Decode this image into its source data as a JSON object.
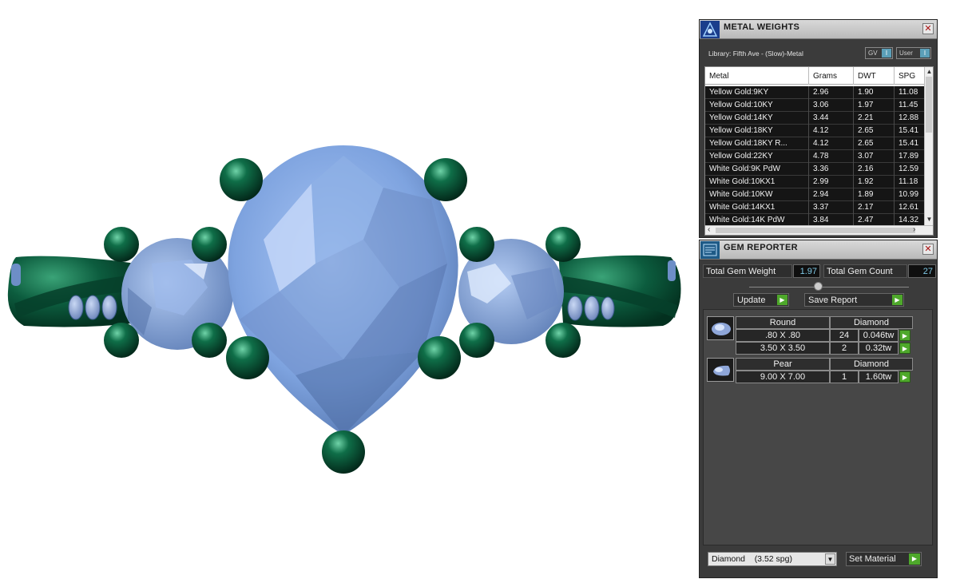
{
  "metal_panel": {
    "title": "METAL WEIGHTS",
    "library_label": "Library: Fifth Ave - (Slow)-Metal",
    "gv_label": "GV",
    "user_label": "User",
    "toggle_glyph": "I",
    "columns": [
      "Metal",
      "Grams",
      "DWT",
      "SPG"
    ],
    "rows": [
      {
        "metal": "Yellow Gold:9KY",
        "grams": "2.96",
        "dwt": "1.90",
        "spg": "11.08"
      },
      {
        "metal": "Yellow Gold:10KY",
        "grams": "3.06",
        "dwt": "1.97",
        "spg": "11.45"
      },
      {
        "metal": "Yellow Gold:14KY",
        "grams": "3.44",
        "dwt": "2.21",
        "spg": "12.88"
      },
      {
        "metal": "Yellow Gold:18KY",
        "grams": "4.12",
        "dwt": "2.65",
        "spg": "15.41"
      },
      {
        "metal": "Yellow Gold:18KY R...",
        "grams": "4.12",
        "dwt": "2.65",
        "spg": "15.41"
      },
      {
        "metal": "Yellow Gold:22KY",
        "grams": "4.78",
        "dwt": "3.07",
        "spg": "17.89"
      },
      {
        "metal": "White Gold:9K PdW",
        "grams": "3.36",
        "dwt": "2.16",
        "spg": "12.59"
      },
      {
        "metal": "White Gold:10KX1",
        "grams": "2.99",
        "dwt": "1.92",
        "spg": "11.18"
      },
      {
        "metal": "White Gold:10KW",
        "grams": "2.94",
        "dwt": "1.89",
        "spg": "10.99"
      },
      {
        "metal": "White Gold:14KX1",
        "grams": "3.37",
        "dwt": "2.17",
        "spg": "12.61"
      },
      {
        "metal": "White Gold:14K PdW",
        "grams": "3.84",
        "dwt": "2.47",
        "spg": "14.32"
      }
    ]
  },
  "gem_panel": {
    "title": "GEM REPORTER",
    "total_weight_label": "Total Gem Weight",
    "total_weight_value": "1.97",
    "total_count_label": "Total Gem Count",
    "total_count_value": "27",
    "update_label": "Update",
    "save_report_label": "Save Report",
    "groups": [
      {
        "shape": "Round",
        "material": "Diamond",
        "rows": [
          {
            "size": ".80 X .80",
            "count": "24",
            "weight": "0.046tw"
          },
          {
            "size": "3.50 X 3.50",
            "count": "2",
            "weight": "0.32tw"
          }
        ]
      },
      {
        "shape": "Pear",
        "material": "Diamond",
        "rows": [
          {
            "size": "9.00 X 7.00",
            "count": "1",
            "weight": "1.60tw"
          }
        ]
      }
    ],
    "material_select": "Diamond    (3.52 spg)",
    "set_material_label": "Set Material"
  },
  "colors": {
    "metal_green": "#0b5a3c",
    "gem_blue": "#7fa6e3",
    "go_green": "#4ea82b",
    "value_cyan": "#7fc9e6"
  },
  "icons": [
    "metal-weights-icon",
    "gem-reporter-icon",
    "close-icon",
    "play-arrow-icon",
    "dropdown-arrow-icon"
  ]
}
